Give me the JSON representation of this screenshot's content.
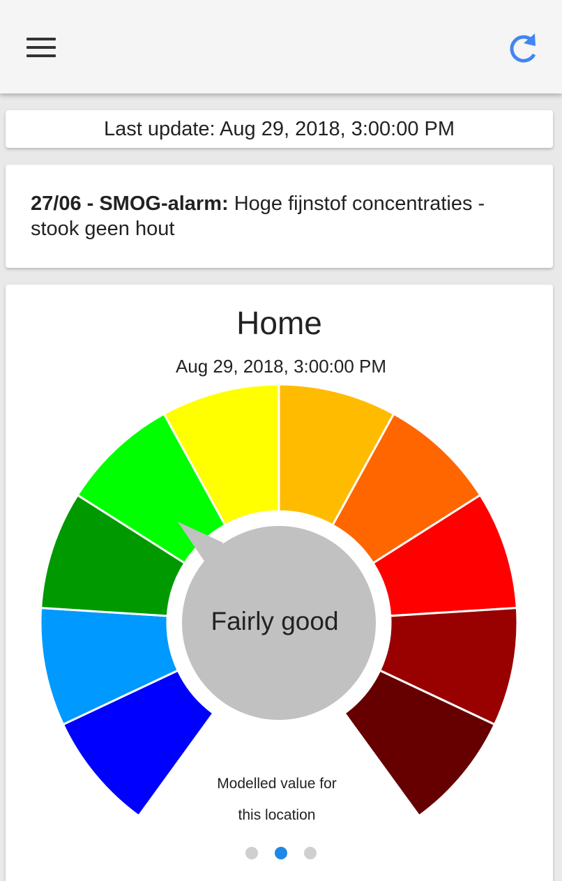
{
  "header": {
    "menu_icon": "hamburger-menu-icon",
    "refresh_icon": "refresh-icon",
    "accent_color": "#4285f4"
  },
  "last_update": {
    "text": "Last update: Aug 29, 2018, 3:00:00 PM"
  },
  "alert": {
    "title": "27/06 - SMOG-alarm:",
    "message": " Hoge fijnstof concentraties - stook geen hout"
  },
  "gauge": {
    "title": "Home",
    "date": "Aug 29, 2018, 3:00:00 PM",
    "level_label": "Fairly good",
    "current_index": 3,
    "segment_colors": [
      "#0000ff",
      "#0099ff",
      "#009900",
      "#00ff00",
      "#ffff00",
      "#ffbb00",
      "#ff6600",
      "#ff0000",
      "#990000",
      "#660000"
    ],
    "note_line1": "Modelled value for",
    "note_line2": "this location"
  },
  "pager": {
    "count": 3,
    "active": 1
  }
}
